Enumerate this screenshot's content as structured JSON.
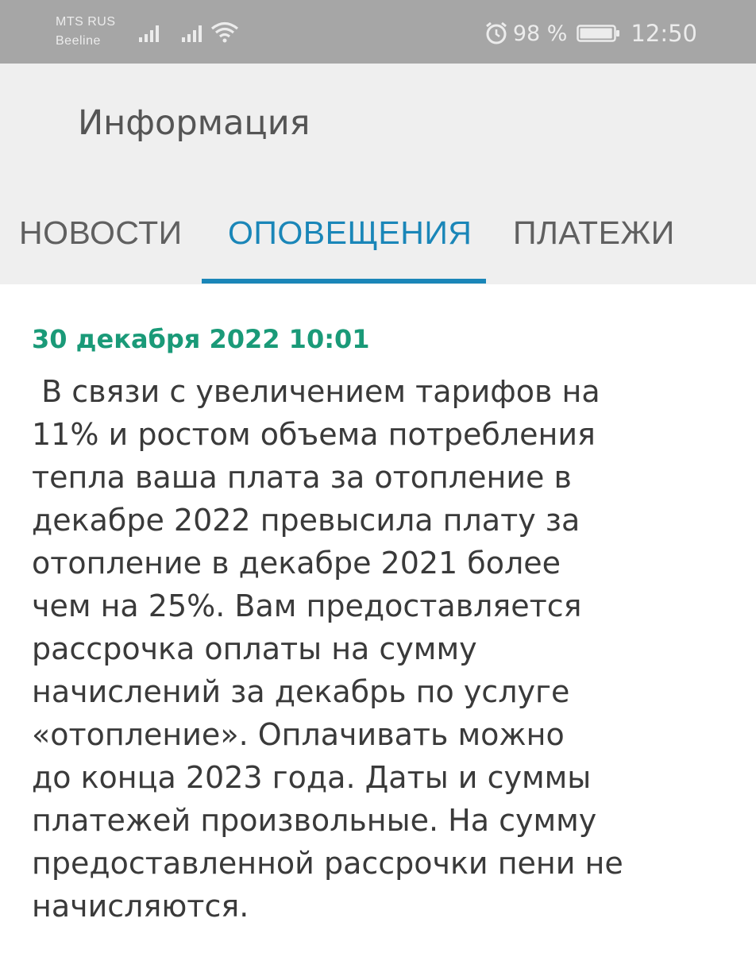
{
  "status_bar": {
    "carrier_1": "MTS RUS",
    "carrier_2": "Beeline",
    "battery_percent": "98 %",
    "battery_level": 0.98,
    "time": "12:50",
    "icons": [
      "signal-icon",
      "signal-icon",
      "wifi-icon",
      "alarm-icon",
      "battery-icon"
    ]
  },
  "header": {
    "title": "Информация"
  },
  "tabs": [
    {
      "label": "НОВОСТИ",
      "active": false
    },
    {
      "label": "ОПОВЕЩЕНИЯ",
      "active": true
    },
    {
      "label": "ПЛАТЕЖИ",
      "active": false
    }
  ],
  "notice": {
    "date": "30 декабря 2022 10:01",
    "lines": [
      " В связи с увеличением тарифов на",
      "11% и ростом объема потребления",
      "тепла ваша плата за отопление в",
      "декабре 2022 превысила плату за",
      "отопление в декабре 2021 более",
      "чем на 25%. Вам предоставляется",
      "рассрочка оплаты на сумму",
      "начислений за декабрь по услуге",
      "«отопление». Оплачивать можно",
      "до конца 2023 года. Даты и суммы",
      "платежей произвольные. На сумму",
      "предоставленной рассрочки пени не",
      "начисляются."
    ]
  },
  "colors": {
    "accent": "#1a86b8",
    "date": "#1a9a78",
    "status_bar": "#a6a6a6",
    "header_bg": "#efefef",
    "text": "#3a3a3a"
  }
}
